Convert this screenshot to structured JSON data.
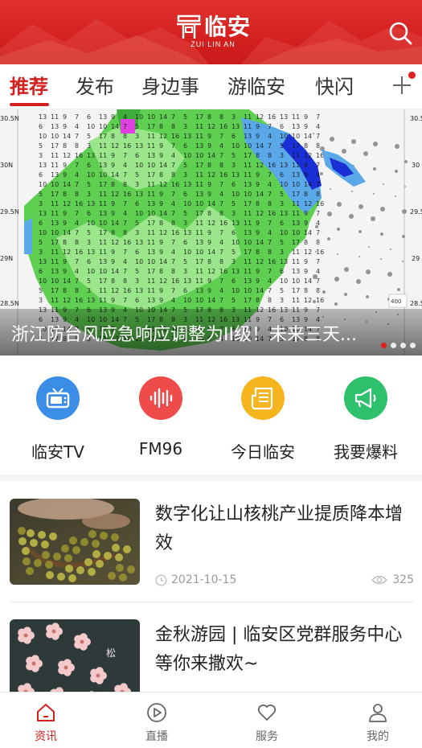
{
  "header": {
    "logo_text": "临安",
    "logo_sub": "ZUI LIN AN",
    "brand_color": "#d4201f"
  },
  "tabs": [
    {
      "label": "推荐",
      "active": true
    },
    {
      "label": "发布",
      "active": false
    },
    {
      "label": "身边事",
      "active": false
    },
    {
      "label": "游临安",
      "active": false
    },
    {
      "label": "快闪",
      "active": false
    }
  ],
  "banner": {
    "caption": "浙江防台风应急响应调整为II级！未来三天...",
    "lat_labels_left": [
      "30.5N",
      "30N",
      "29.5N",
      "29N",
      "28.5N"
    ],
    "lat_labels_right": [
      "30.5",
      "30",
      "29.5",
      "29",
      "28.5"
    ],
    "legend_value": "400",
    "active_dot": 0,
    "dot_count": 4
  },
  "quick_entries": [
    {
      "label": "临安TV",
      "icon": "tv-icon",
      "color": "#3a8ee6"
    },
    {
      "label": "FM96",
      "icon": "sound-wave-icon",
      "color": "#ef4b4b"
    },
    {
      "label": "今日临安",
      "icon": "newspaper-icon",
      "color": "#f6b41e"
    },
    {
      "label": "我要爆料",
      "icon": "megaphone-icon",
      "color": "#2fc06b"
    }
  ],
  "news": [
    {
      "title": "数字化让山核桃产业提质降本增效",
      "date": "2021-10-15",
      "views": "325"
    },
    {
      "title": "金秋游园 | 临安区党群服务中心等你来撒欢~",
      "date": "",
      "views": ""
    }
  ],
  "bottom_nav": [
    {
      "label": "资讯",
      "icon": "home-icon",
      "active": true
    },
    {
      "label": "直播",
      "icon": "play-icon",
      "active": false
    },
    {
      "label": "服务",
      "icon": "heart-icon",
      "active": false
    },
    {
      "label": "我的",
      "icon": "user-icon",
      "active": false
    }
  ]
}
